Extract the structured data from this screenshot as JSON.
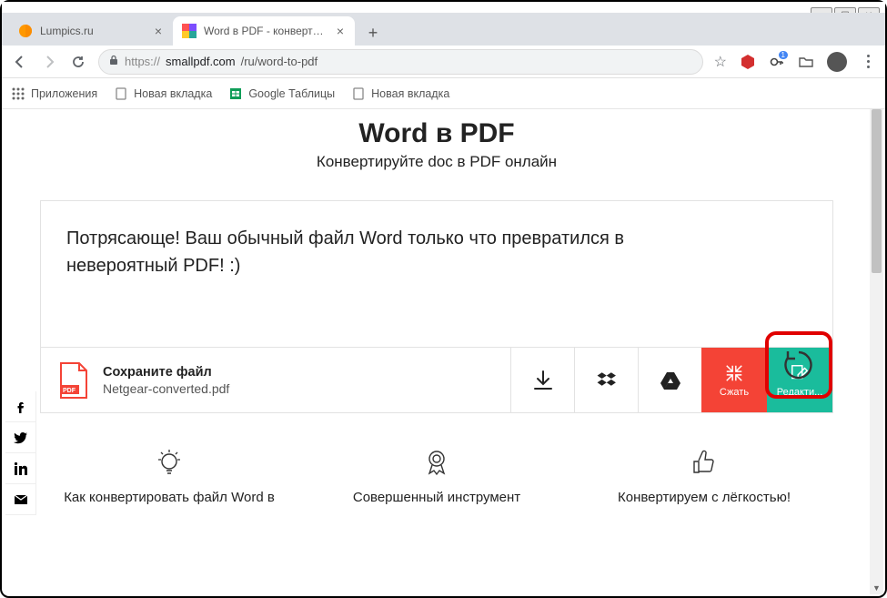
{
  "window": {
    "minimize": "–",
    "maximize": "☐",
    "close": "✕"
  },
  "tabs": [
    {
      "title": "Lumpics.ru"
    },
    {
      "title": "Word в PDF - конвертируйте DC"
    }
  ],
  "newtab": "+",
  "url": {
    "proto": "https://",
    "host": "smallpdf.com",
    "path": "/ru/word-to-pdf"
  },
  "star": "☆",
  "bookmarks": {
    "apps": "Приложения",
    "newtab": "Новая вкладка",
    "sheets": "Google Таблицы",
    "newtab2": "Новая вкладка"
  },
  "page": {
    "title": "Word в PDF",
    "subtitle": "Конвертируйте doc в PDF онлайн",
    "success": "Потрясающе! Ваш обычный файл Word только что превратился в невероятный PDF! :)",
    "save_title": "Сохраните файл",
    "filename": "Netgear-converted.pdf",
    "compress": "Сжать",
    "edit": "Редакти...",
    "features": [
      "Как конвертировать файл Word в",
      "Совершенный инструмент",
      "Конвертируем с лёгкостью!"
    ]
  }
}
